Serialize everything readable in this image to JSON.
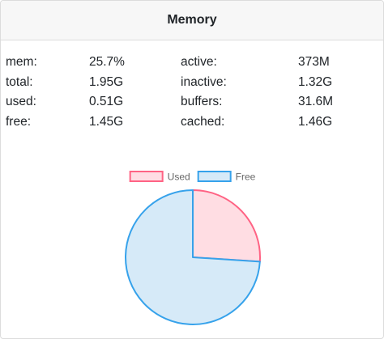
{
  "title": "Memory",
  "stats": [
    {
      "label1": "mem:",
      "value1": "25.7%",
      "label2": "active:",
      "value2": "373M"
    },
    {
      "label1": "total:",
      "value1": "1.95G",
      "label2": "inactive:",
      "value2": "1.32G"
    },
    {
      "label1": "used:",
      "value1": "0.51G",
      "label2": "buffers:",
      "value2": "31.6M"
    },
    {
      "label1": "free:",
      "value1": "1.45G",
      "label2": "cached:",
      "value2": "1.46G"
    }
  ],
  "chart_data": {
    "type": "pie",
    "legend_position": "top",
    "categories": [
      "Used",
      "Free"
    ],
    "values": [
      0.51,
      1.45
    ],
    "colors": {
      "Used": {
        "fill": "#ffdde3",
        "stroke": "#ff6384"
      },
      "Free": {
        "fill": "#d6eaf8",
        "stroke": "#36a2eb"
      }
    }
  }
}
